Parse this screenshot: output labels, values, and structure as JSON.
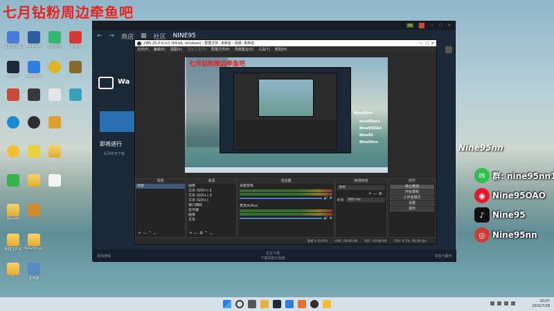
{
  "overlay_title": "七月钻粉周边牵鱼吧",
  "desktop_labels": [
    "设置提示来发送到的",
    "Wallpaper",
    "QQ音乐",
    "网易云",
    "Steam",
    "WeGame",
    "Nine95",
    "新建文件夹",
    "Nine95ngo",
    "C:",
    "此电脑"
  ],
  "steam": {
    "nav": [
      "商店",
      "社区",
      "NINE95"
    ],
    "side_title": "Wa",
    "upcoming": "即将进行",
    "upcoming_sub": "队列中无下载",
    "badge": "16",
    "bottom_left": "添加游戏",
    "bottom_center_1": "正在下载",
    "bottom_center_2": "下载内容已完成",
    "bottom_right": "好友与聊天"
  },
  "obs": {
    "title": "OBS 25.0.0-rc1 (64-bit, windows) - 配置文件: 未命名 - 场景: 未命名",
    "menu": [
      "文件(F)",
      "编辑(E)",
      "视图(V)",
      "固定工具(D)",
      "配置文件(P)",
      "场景集合(S)",
      "工具(T)",
      "帮助(H)"
    ],
    "preview_title": "七月钻粉周边牵鱼吧",
    "docks": {
      "scenes": {
        "title": "场景",
        "items": [
          "场景"
        ]
      },
      "sources": {
        "title": "来源",
        "items": [
          "图像",
          "文本 (GDI+) 2",
          "文本 (GDI+) 3",
          "文本 (GDI+)",
          "窗口捕获",
          "显示器",
          "图像",
          "文本"
        ]
      },
      "mixer": {
        "title": "混音器",
        "ch1": "桌面音频",
        "ch2": "麦克风/Aux",
        "db": "0.0 dB"
      },
      "transitions": {
        "title": "转场特效",
        "type": "淡出",
        "duration_label": "时长",
        "duration": "300 ms"
      },
      "controls": {
        "title": "控件",
        "buttons": [
          "停止推流",
          "开始录制",
          "工作室模式",
          "设置",
          "退出"
        ]
      }
    },
    "status": {
      "live": "LIVE: 00:00:00",
      "rec": "REC: 00:00:00",
      "cpu": "CPU: 0.5%, 60.00 fps",
      "dropped": "丢帧 0 (0.0%)"
    }
  },
  "overlay_social": {
    "name": "Nine95nn",
    "wechat": "群: nine95nn1",
    "weibo": "Nine95OAO",
    "douyin": "Nine95",
    "netease": "Nine95nn"
  },
  "mini_overlay": [
    "Nine95nn",
    "nine95nn1",
    "Nine95OAO",
    "Nine95",
    "Nine95nn"
  ],
  "taskbar": {
    "time": "20:07",
    "date": "2022/7/28"
  },
  "colors": {
    "overlay_red": "#e8231f",
    "steam_bg": "#1b2838",
    "obs_bg": "#2b2b2b"
  }
}
